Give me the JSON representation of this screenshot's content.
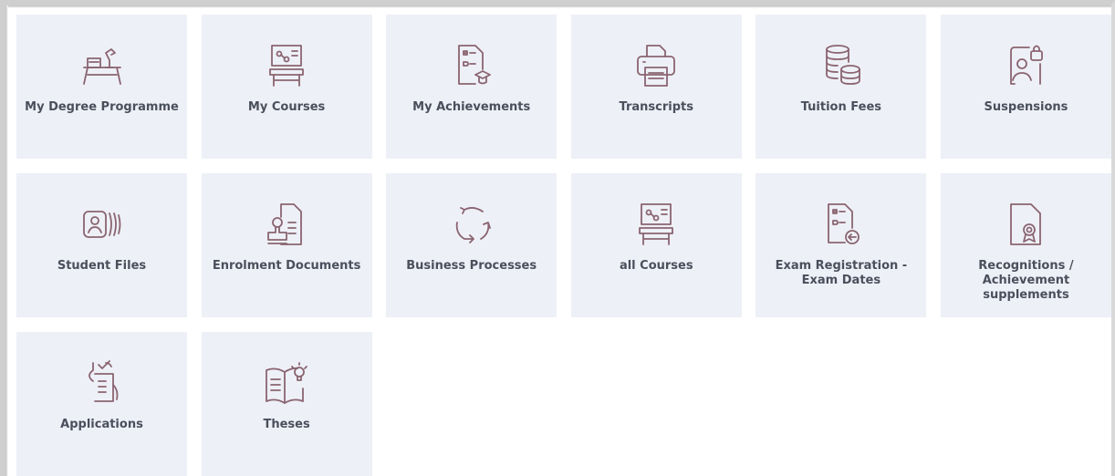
{
  "tiles": [
    {
      "label": "My Degree Programme",
      "icon": "desk-icon"
    },
    {
      "label": "My Courses",
      "icon": "lectern-presentation-icon"
    },
    {
      "label": "My Achievements",
      "icon": "grade-sheet-graduation-icon"
    },
    {
      "label": "Transcripts",
      "icon": "printer-icon"
    },
    {
      "label": "Tuition Fees",
      "icon": "coin-stack-icon"
    },
    {
      "label": "Suspensions",
      "icon": "person-lock-icon"
    },
    {
      "label": "Student Files",
      "icon": "person-card-icon"
    },
    {
      "label": "Enrolment Documents",
      "icon": "stamp-document-icon"
    },
    {
      "label": "Business Processes",
      "icon": "cycle-arrows-icon"
    },
    {
      "label": "all Courses",
      "icon": "lectern-presentation-icon"
    },
    {
      "label": "Exam Registration - Exam Dates",
      "icon": "grade-sheet-arrow-icon"
    },
    {
      "label": "Recognitions / Achievement supplements",
      "icon": "document-badge-icon"
    },
    {
      "label": "Applications",
      "icon": "hand-checklist-icon"
    },
    {
      "label": "Theses",
      "icon": "book-lightbulb-icon"
    }
  ],
  "colors": {
    "tile_bg": "#eef0f7",
    "icon": "#8a6470",
    "label": "#4a4f5c"
  }
}
